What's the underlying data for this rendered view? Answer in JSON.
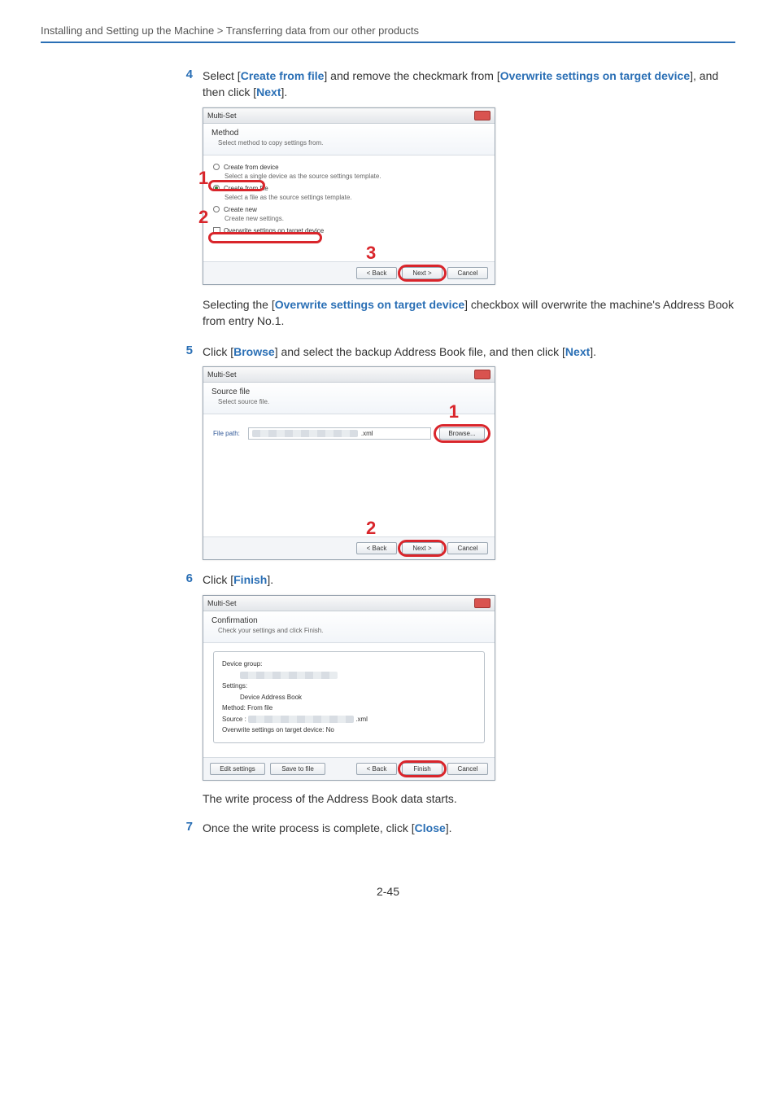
{
  "breadcrumb": "Installing and Setting up the Machine > Transferring data from our other products",
  "steps": {
    "s4": {
      "num": "4",
      "pre": "Select [",
      "kw1": "Create from file",
      "mid1": "] and remove the checkmark from [",
      "kw2": "Overwrite settings on target device",
      "mid2": "], and then click [",
      "kw3": "Next",
      "post": "]."
    },
    "note_overwrite": {
      "pre": "Selecting the [",
      "kw": "Overwrite settings on target device",
      "post": "] checkbox will overwrite the machine's Address Book from entry No.1."
    },
    "s5": {
      "num": "5",
      "pre": "Click [",
      "kw1": "Browse",
      "mid1": "] and select the backup Address Book file, and then click [",
      "kw2": "Next",
      "post": "]."
    },
    "s6": {
      "num": "6",
      "pre": "Click [",
      "kw": "Finish",
      "post": "]."
    },
    "s6_note": "The write process of the Address Book data starts.",
    "s7": {
      "num": "7",
      "pre": "Once the write process is complete, click [",
      "kw": "Close",
      "post": "]."
    }
  },
  "dlg1": {
    "title": "Multi-Set",
    "h1": "Method",
    "h2": "Select method to copy settings from.",
    "r1": "Create from device",
    "r1s": "Select a single device as the source settings template.",
    "r2": "Create from file",
    "r2s": "Select a file as the source settings template.",
    "r3": "Create new",
    "r3s": "Create new settings.",
    "chk": "Overwrite settings on target device",
    "back": "< Back",
    "next": "Next >",
    "cancel": "Cancel",
    "call1": "1",
    "call2": "2",
    "call3": "3"
  },
  "dlg2": {
    "title": "Multi-Set",
    "h1": "Source file",
    "h2": "Select source file.",
    "lbl_path": "File path:",
    "ext": ".xml",
    "browse": "Browse...",
    "back": "< Back",
    "next": "Next >",
    "cancel": "Cancel",
    "call1": "1",
    "call2": "2"
  },
  "dlg3": {
    "title": "Multi-Set",
    "h1": "Confirmation",
    "h2": "Check your settings and click Finish.",
    "l_devgrp": "Device group:",
    "l_settings": "Settings:",
    "v_settings": "Device Address Book",
    "l_method": "Method: From file",
    "l_source": "Source :",
    "ext": ".xml",
    "l_over": "Overwrite settings on target device: No",
    "edit": "Edit settings",
    "save": "Save to file",
    "back": "< Back",
    "finish": "Finish",
    "cancel": "Cancel"
  },
  "page_number": "2-45"
}
